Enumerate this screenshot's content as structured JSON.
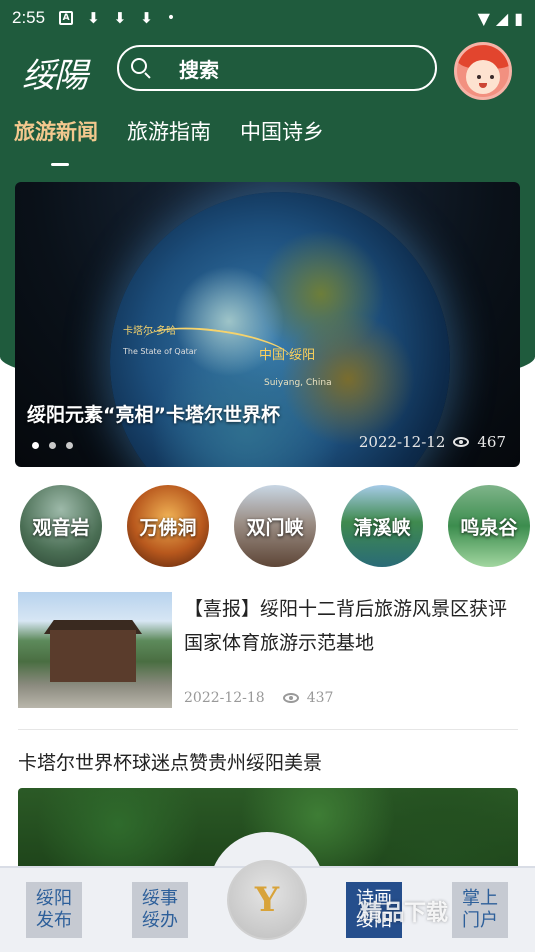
{
  "status_bar": {
    "time": "2:55",
    "icons_left": [
      "a-box-icon",
      "download-icon",
      "download-icon",
      "download-icon",
      "dot-icon"
    ],
    "icons_right": [
      "wifi-icon",
      "signal-icon",
      "battery-icon"
    ]
  },
  "header": {
    "logo_text": "绥陽",
    "search_placeholder": "搜索",
    "accent_color": "#1f5b3d"
  },
  "tabs": [
    {
      "label": "旅游新闻",
      "active": true
    },
    {
      "label": "旅游指南",
      "active": false
    },
    {
      "label": "中国诗乡",
      "active": false
    }
  ],
  "banner": {
    "title": "绥阳元素“亮相”卡塔尔世界杯",
    "date": "2022-12-12",
    "views": "467",
    "marker_a": "卡塔尔·多哈",
    "marker_a_en": "The State of Qatar",
    "marker_b": "中国·绥阳",
    "marker_b_en": "Suiyang, China",
    "slide_count": 3,
    "active_slide": 1
  },
  "scenic_spots": [
    {
      "name": "观音岩"
    },
    {
      "name": "万佛洞"
    },
    {
      "name": "双门峡"
    },
    {
      "name": "清溪峡"
    },
    {
      "name": "鸣泉谷"
    }
  ],
  "news": [
    {
      "title": "【喜报】绥阳十二背后旅游风景区获评国家体育旅游示范基地",
      "date": "2022-12-18",
      "views": "437"
    },
    {
      "title": "卡塔尔世界杯球迷点赞贵州绥阳美景"
    }
  ],
  "bottom_nav": [
    {
      "label": "绥阳发布",
      "line1": "绥阳",
      "line2": "发布"
    },
    {
      "label": "绥事绥办",
      "line1": "绥事",
      "line2": "绥办"
    },
    {
      "label": "center",
      "glyph": "Y"
    },
    {
      "label": "诗画绥阳",
      "line1": "诗画",
      "line2": "绥阳"
    },
    {
      "label": "掌上门户",
      "line1": "掌上",
      "line2": "门户"
    }
  ],
  "watermark": "精品下载"
}
